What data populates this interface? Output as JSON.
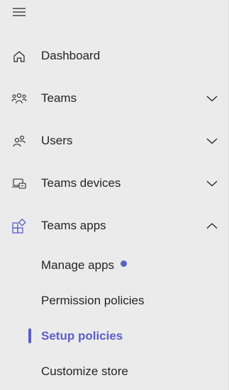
{
  "nav": {
    "menu_icon": "hamburger-icon",
    "items": [
      {
        "label": "Dashboard",
        "icon": "home-icon"
      },
      {
        "label": "Teams",
        "icon": "teams-icon",
        "expanded": false
      },
      {
        "label": "Users",
        "icon": "users-icon",
        "expanded": false
      },
      {
        "label": "Teams devices",
        "icon": "devices-icon",
        "expanded": false
      },
      {
        "label": "Teams apps",
        "icon": "apps-icon",
        "expanded": true
      }
    ],
    "sub_items": [
      {
        "label": "Manage apps",
        "has_notification_dot": true
      },
      {
        "label": "Permission policies"
      },
      {
        "label": "Setup policies",
        "active": true
      },
      {
        "label": "Customize store"
      }
    ]
  },
  "colors": {
    "background": "#ebebeb",
    "text": "#242424",
    "accent": "#5b5fc7"
  }
}
